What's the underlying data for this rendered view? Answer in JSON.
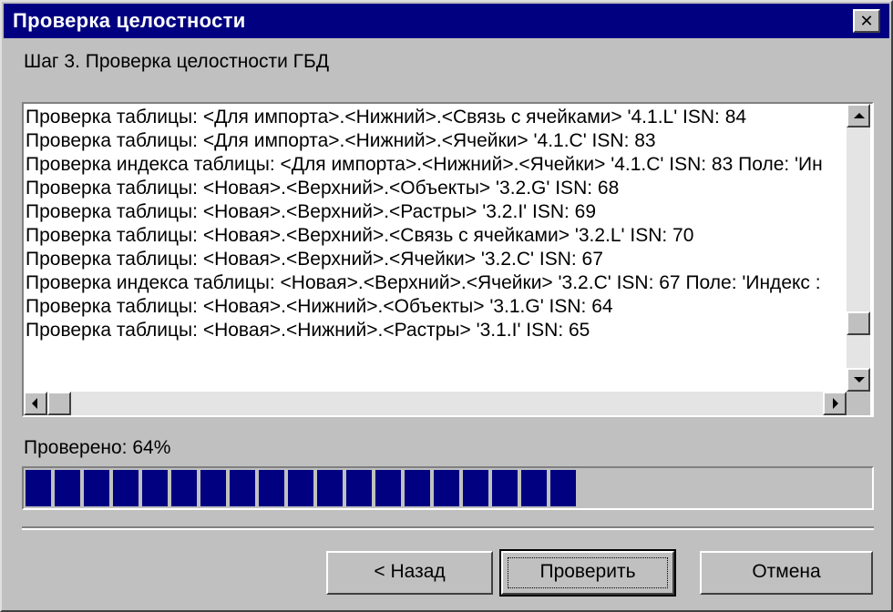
{
  "window": {
    "title": "Проверка целостности",
    "close_glyph": "✕"
  },
  "step_text": "Шаг 3. Проверка целостности ГБД",
  "log": {
    "lines": [
      "Проверка таблицы: <Для импорта>.<Нижний>.<Связь с ячейками> '4.1.L' ISN: 84",
      "Проверка таблицы: <Для импорта>.<Нижний>.<Ячейки> '4.1.C' ISN: 83",
      "Проверка индекса таблицы: <Для импорта>.<Нижний>.<Ячейки> '4.1.C' ISN: 83 Поле: 'Ин",
      "Проверка таблицы: <Новая>.<Верхний>.<Объекты> '3.2.G' ISN: 68",
      "Проверка таблицы: <Новая>.<Верхний>.<Растры> '3.2.I' ISN: 69",
      "Проверка таблицы: <Новая>.<Верхний>.<Связь с ячейками> '3.2.L' ISN: 70",
      "Проверка таблицы: <Новая>.<Верхний>.<Ячейки> '3.2.C' ISN: 67",
      "Проверка индекса таблицы: <Новая>.<Верхний>.<Ячейки> '3.2.C' ISN: 67 Поле: 'Индекс :",
      "Проверка таблицы: <Новая>.<Нижний>.<Объекты> '3.1.G' ISN: 64",
      "Проверка таблицы: <Новая>.<Нижний>.<Растры> '3.1.I' ISN: 65"
    ],
    "vscroll_position": 0.85
  },
  "progress": {
    "label": "Проверено: 64%",
    "value": 0.65
  },
  "buttons": {
    "back": "< Назад",
    "check": "Проверить",
    "cancel": "Отмена"
  },
  "colors": {
    "title_bar": "#000080",
    "progress_fill": "#000080",
    "face": "#c0c0c0"
  }
}
